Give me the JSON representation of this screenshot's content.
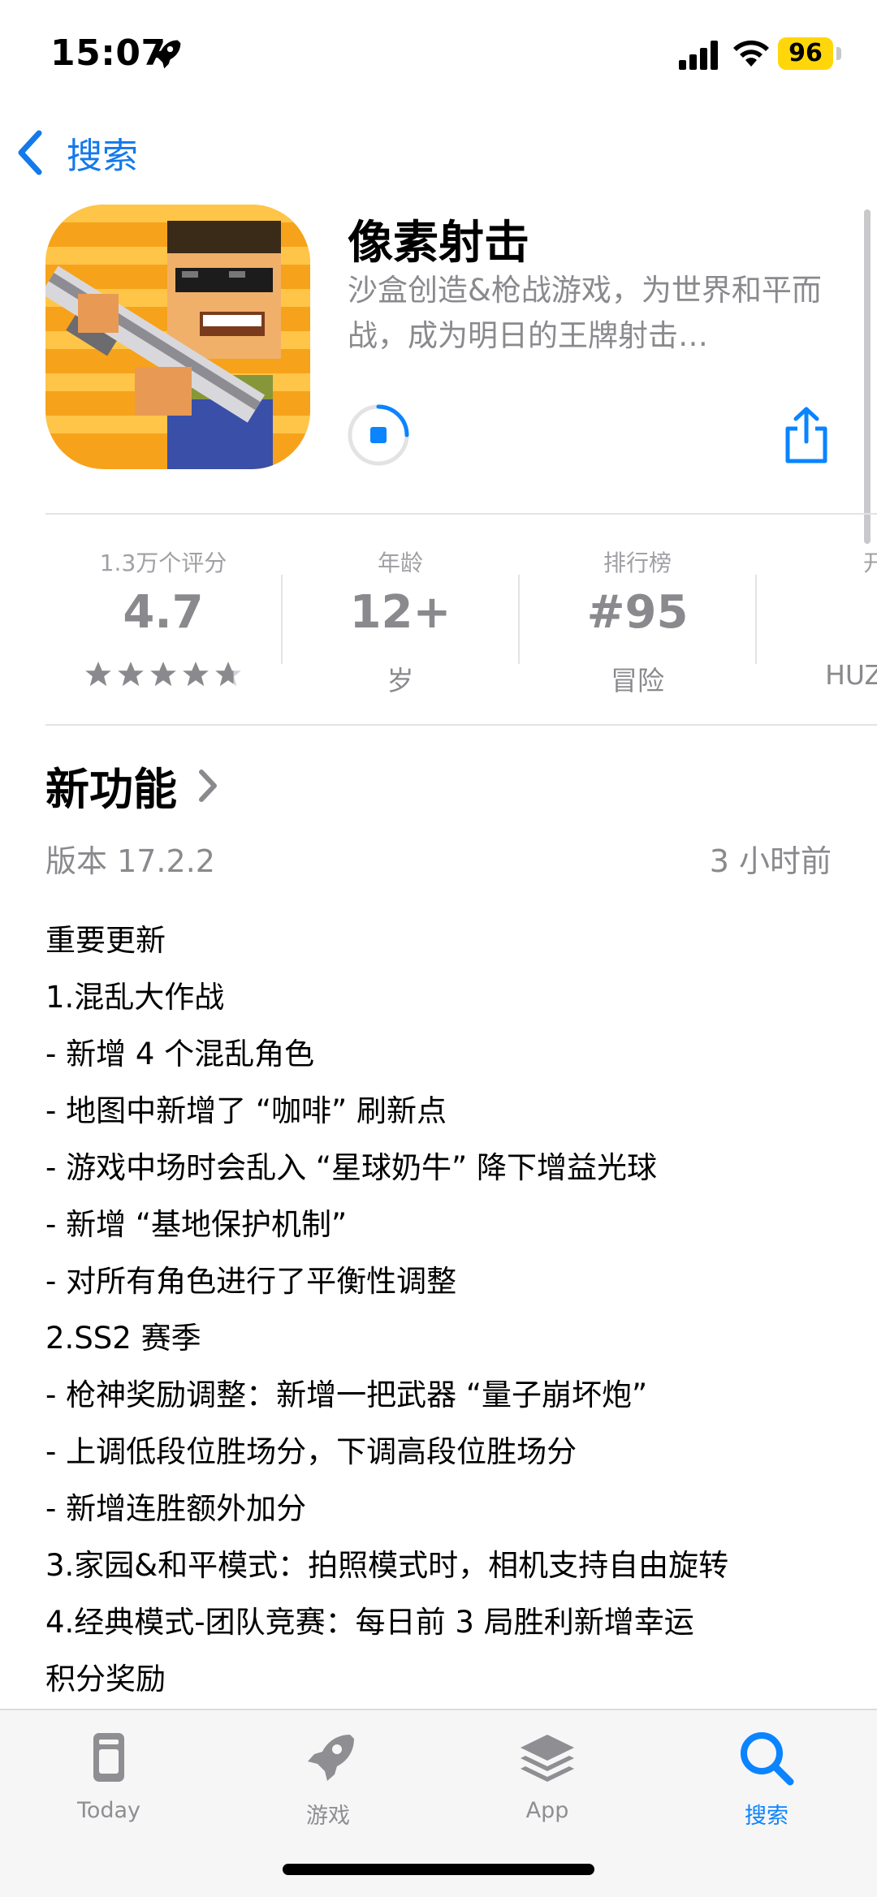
{
  "status_bar": {
    "time": "15:07",
    "battery": "96"
  },
  "nav": {
    "back_label": "搜索"
  },
  "app": {
    "title": "像素射击",
    "subtitle": "沙盒创造&枪战游戏，为世界和平而战，成为明日的王牌射击…",
    "icon": "pixel-shooter-app-icon"
  },
  "stats": [
    {
      "label": "1.3万个评分",
      "value": "4.7",
      "stars": 4.7
    },
    {
      "label": "年龄",
      "value": "12+",
      "sub": "岁"
    },
    {
      "label": "排行榜",
      "value": "#95",
      "sub": "冒险"
    },
    {
      "label": "开",
      "value": "",
      "sub": "HUZHO"
    }
  ],
  "whats_new": {
    "title": "新功能",
    "version": "版本 17.2.2",
    "time_ago": "3 小时前",
    "notes": [
      "重要更新",
      "1.混乱大作战",
      "- 新增 4 个混乱角色",
      "- 地图中新增了 “咖啡” 刷新点",
      "- 游戏中场时会乱入 “星球奶牛” 降下增益光球",
      "- 新增 “基地保护机制”",
      "- 对所有角色进行了平衡性调整",
      "2.SS2 赛季",
      "- 枪神奖励调整：新增一把武器 “量子崩坏炮”",
      "- 上调低段位胜场分，下调高段位胜场分",
      "- 新增连胜额外加分",
      "3.家园&和平模式：拍照模式时，相机支持自由旋转",
      "4.经典模式-团队竞赛：每日前 3 局胜利新增幸运",
      "积分奖励"
    ]
  },
  "tab_bar": {
    "tabs": [
      {
        "label": "Today",
        "icon": "today-icon"
      },
      {
        "label": "游戏",
        "icon": "rocket-icon"
      },
      {
        "label": "App",
        "icon": "apps-stack-icon"
      },
      {
        "label": "搜索",
        "icon": "search-icon",
        "active": true
      }
    ]
  },
  "colors": {
    "accent": "#0a84ff",
    "battery": "#ffd60a",
    "secondary_text": "#8a8a8e"
  }
}
